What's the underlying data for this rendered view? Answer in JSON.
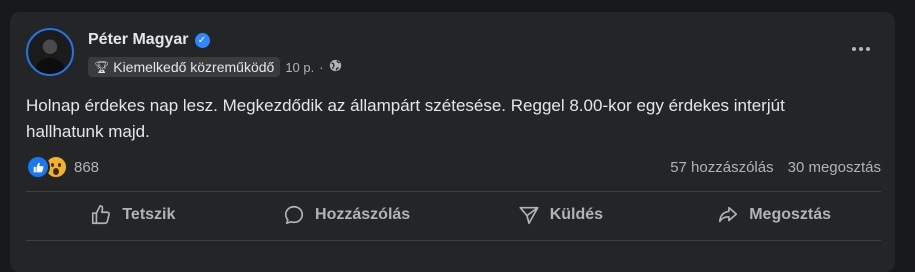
{
  "post": {
    "author": "Péter Magyar",
    "verified_icon": "verified-check-icon",
    "badge_icon": "trophy-icon",
    "badge_label": "Kiemelkedő közreműködő",
    "time": "10 p.",
    "separator": "·",
    "audience_icon": "globe-icon",
    "text": "Holnap érdekes nap lesz. Megkezdődik az állampárt szétesése. Reggel 8.00-kor egy érdekes interjút hallhatunk majd."
  },
  "stats": {
    "reaction_count": "868",
    "comments": "57 hozzászólás",
    "shares": "30 megosztás"
  },
  "actions": {
    "like": "Tetszik",
    "comment": "Hozzászólás",
    "send": "Küldés",
    "share": "Megosztás"
  },
  "colors": {
    "background": "#18191a",
    "card": "#242526",
    "accent": "#2d88ff",
    "like_blue": "#1877f2",
    "wow_yellow": "#f7b125"
  }
}
